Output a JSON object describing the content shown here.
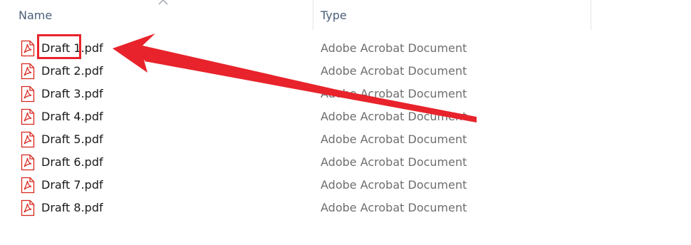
{
  "columns": {
    "name_label": "Name",
    "type_label": "Type"
  },
  "icons": {
    "sort": "chevron-up-icon",
    "file": "pdf-file-icon"
  },
  "colors": {
    "annotation": "#e8232b",
    "pdf_icon": "#d9261c",
    "header_text": "#4c607a",
    "type_text": "#6e6e6e"
  },
  "files": [
    {
      "name": "Draft 1.pdf",
      "type": "Adobe Acrobat Document"
    },
    {
      "name": "Draft 2.pdf",
      "type": "Adobe Acrobat Document"
    },
    {
      "name": "Draft 3.pdf",
      "type": "Adobe Acrobat Document"
    },
    {
      "name": "Draft 4.pdf",
      "type": "Adobe Acrobat Document"
    },
    {
      "name": "Draft 5.pdf",
      "type": "Adobe Acrobat Document"
    },
    {
      "name": "Draft 6.pdf",
      "type": "Adobe Acrobat Document"
    },
    {
      "name": "Draft 7.pdf",
      "type": "Adobe Acrobat Document"
    },
    {
      "name": "Draft 8.pdf",
      "type": "Adobe Acrobat Document"
    }
  ]
}
